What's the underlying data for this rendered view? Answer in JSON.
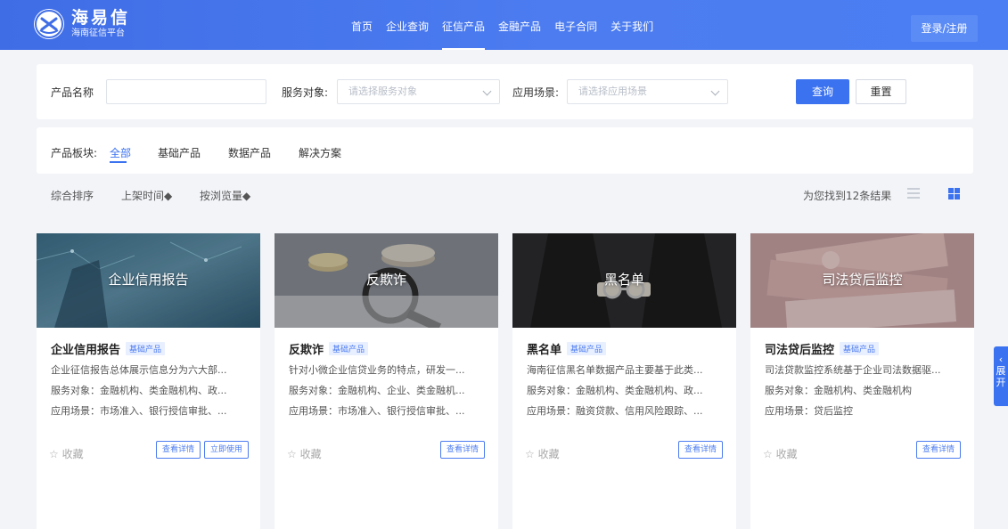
{
  "brand": {
    "title": "海易信",
    "subtitle": "海南征信平台"
  },
  "nav": [
    {
      "label": "首页"
    },
    {
      "label": "企业查询"
    },
    {
      "label": "征信产品",
      "active": true
    },
    {
      "label": "金融产品"
    },
    {
      "label": "电子合同"
    },
    {
      "label": "关于我们"
    }
  ],
  "login_label": "登录/注册",
  "search": {
    "name_label": "产品名称",
    "name_value": "",
    "service_label": "服务对象:",
    "service_placeholder": "请选择服务对象",
    "scene_label": "应用场景:",
    "scene_placeholder": "请选择应用场景",
    "search_btn": "查询",
    "reset_btn": "重置"
  },
  "categories": {
    "label": "产品板块:",
    "tabs": [
      {
        "label": "全部",
        "active": true
      },
      {
        "label": "基础产品"
      },
      {
        "label": "数据产品"
      },
      {
        "label": "解决方案"
      }
    ]
  },
  "sort": {
    "items": [
      "综合排序",
      "上架时间◆",
      "按浏览量◆"
    ],
    "result_text": "为您找到12条结果",
    "active_view": "grid"
  },
  "cards": [
    {
      "image_title": "企业信用报告",
      "title": "企业信用报告",
      "badge": "基础产品",
      "desc": "企业征信报告总体展示信息分为六大部...",
      "target": "服务对象：金融机构、类金融机构、政...",
      "scene": "应用场景：市场准入、银行授信审批、...",
      "fav": "☆ 收藏",
      "buttons": [
        "查看详情",
        "立即使用"
      ]
    },
    {
      "image_title": "反欺诈",
      "title": "反欺诈",
      "badge": "基础产品",
      "desc": "针对小微企业信贷业务的特点，研发一...",
      "target": "服务对象：金融机构、企业、类金融机...",
      "scene": "应用场景：市场准入、银行授信审批、...",
      "fav": "☆ 收藏",
      "buttons": [
        "查看详情"
      ]
    },
    {
      "image_title": "黑名单",
      "title": "黑名单",
      "badge": "基础产品",
      "desc": "海南征信黑名单数据产品主要基于此类...",
      "target": "服务对象：金融机构、类金融机构、政...",
      "scene": "应用场景：融资贷款、信用风险跟踪、...",
      "fav": "☆ 收藏",
      "buttons": [
        "查看详情"
      ]
    },
    {
      "image_title": "司法贷后监控",
      "title": "司法贷后监控",
      "badge": "基础产品",
      "desc": "司法贷款监控系统基于企业司法数据驱...",
      "target": "服务对象：金融机构、类金融机构",
      "scene": "应用场景：贷后监控",
      "fav": "☆ 收藏",
      "buttons": [
        "查看详情"
      ]
    }
  ],
  "side_tab": {
    "arrow": "‹",
    "chars": [
      "展",
      "开"
    ]
  },
  "colors": {
    "primary": "#3b72f0",
    "header": "#4a7cf0",
    "background": "#f2f4f8"
  }
}
